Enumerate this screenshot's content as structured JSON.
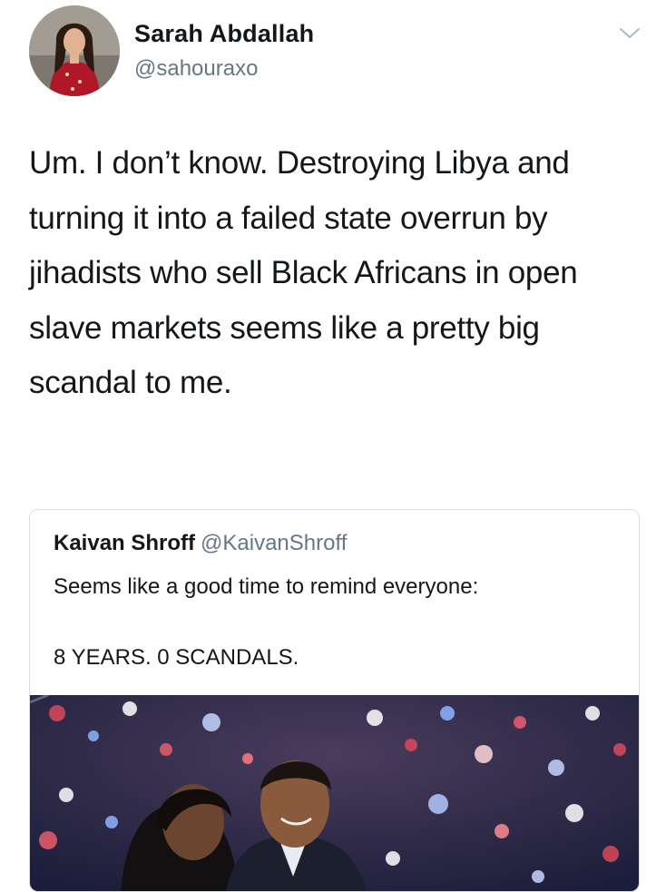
{
  "author": {
    "name": "Sarah Abdallah",
    "handle": "@sahouraxo",
    "avatar_icon": "profile-photo"
  },
  "menu_icon": "chevron-down-icon",
  "tweet": {
    "text": "Um. I don’t know. Destroying Libya and turning it into a failed state overrun by jihadists who sell Black Africans in open slave markets seems like a pretty big scandal to me."
  },
  "quoted_tweet": {
    "name": "Kaivan Shroff",
    "handle": "@KaivanShroff",
    "line1": "Seems like a good time to remind everyone:",
    "line2": "8 YEARS. 0 SCANDALS.",
    "media_icon": "photo-of-couple-with-confetti-background"
  },
  "colors": {
    "text": "#14171a",
    "secondary": "#657786",
    "border": "#d6dde3"
  }
}
